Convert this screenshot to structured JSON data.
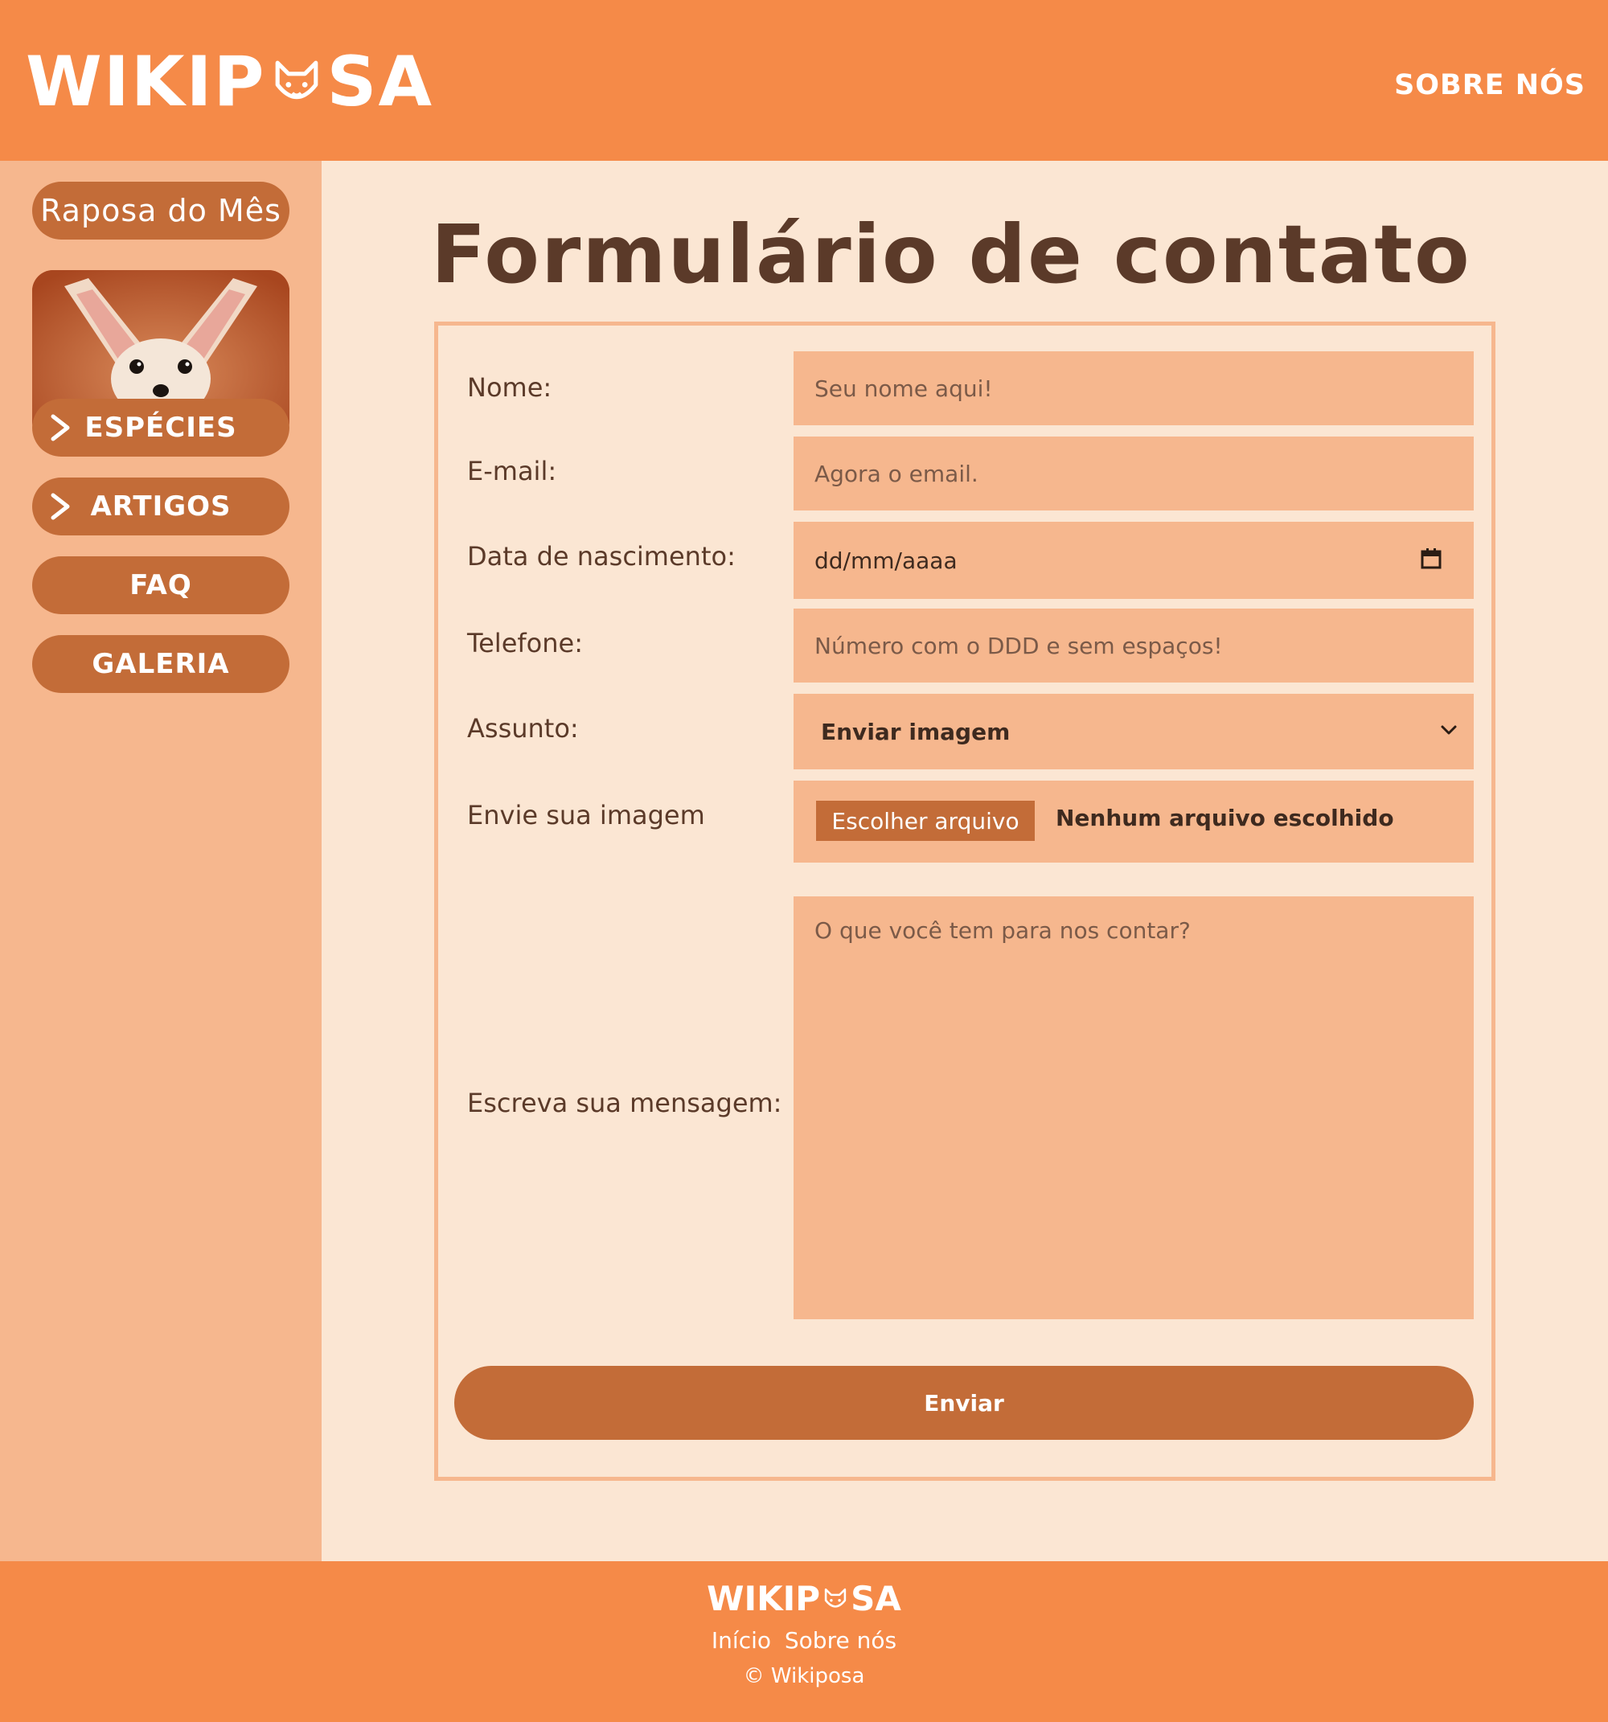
{
  "header": {
    "logo_left": "WIKIP",
    "logo_right": "SA",
    "about_link": "SOBRE NÓS"
  },
  "sidebar": {
    "fox_of_month": "Raposa do Mês",
    "items": [
      {
        "label": "ESPÉCIES",
        "has_chevron": true
      },
      {
        "label": "ARTIGOS",
        "has_chevron": true
      },
      {
        "label": "FAQ",
        "has_chevron": false
      },
      {
        "label": "GALERIA",
        "has_chevron": false
      }
    ]
  },
  "main": {
    "title": "Formulário de contato",
    "form": {
      "name_label": "Nome:",
      "name_placeholder": "Seu nome aqui!",
      "email_label": "E-mail:",
      "email_placeholder": "Agora o email.",
      "birth_label": "Data de nascimento:",
      "birth_value": "dd/mm/aaaa",
      "phone_label": "Telefone:",
      "phone_placeholder": "Número com o DDD e sem espaços!",
      "subject_label": "Assunto:",
      "subject_value": "Enviar imagem",
      "image_label": "Envie sua imagem",
      "file_button": "Escolher arquivo",
      "file_status": "Nenhum arquivo escolhido",
      "message_label": "Escreva sua mensagem:",
      "message_placeholder": "O que você tem para nos contar?",
      "submit": "Enviar"
    }
  },
  "footer": {
    "logo_left": "WIKIP",
    "logo_right": "SA",
    "link_home": "Início",
    "link_about": "Sobre nós",
    "copyright": "© Wikiposa"
  },
  "colors": {
    "header": "#f58a48",
    "sidebar": "#f6b78e",
    "background": "#fbe6d3",
    "button": "#c36c38",
    "text": "#5b3a29"
  }
}
